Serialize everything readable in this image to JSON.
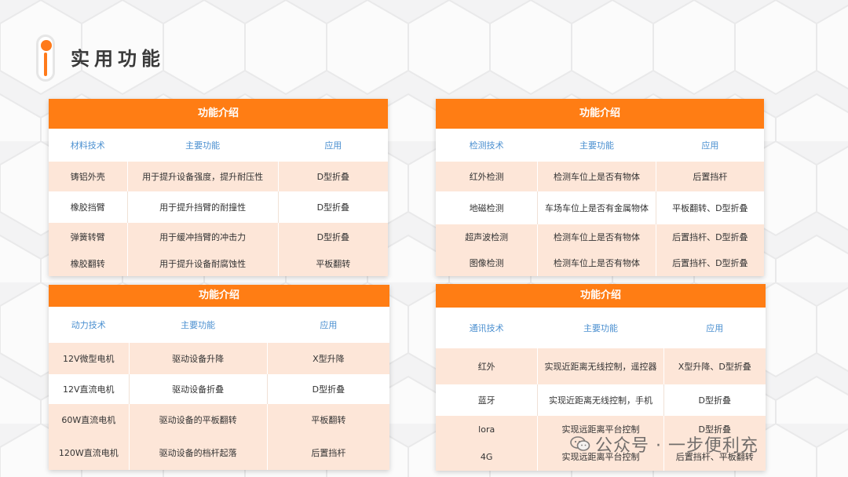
{
  "page": {
    "title": "实用功能"
  },
  "watermark": "公众号 · 一步便利充",
  "colors": {
    "accent": "#ff7d14",
    "row_shade": "#fde6d8",
    "header_text": "#4a8fd0"
  },
  "cards": [
    {
      "title": "功能介绍",
      "headers": [
        "材料技术",
        "主要功能",
        "应用"
      ],
      "rows": [
        [
          "铸铝外壳",
          "用于提升设备强度，提升耐压性",
          "D型折叠"
        ],
        [
          "橡胶挡臂",
          "用于提升挡臂的耐撞性",
          "D型折叠"
        ],
        [
          "弹簧转臂",
          "用于缓冲挡臂的冲击力",
          "D型折叠"
        ],
        [
          "橡胶翻转",
          "用于提升设备耐腐蚀性",
          "平板翻转"
        ]
      ]
    },
    {
      "title": "功能介绍",
      "headers": [
        "检测技术",
        "主要功能",
        "应用"
      ],
      "rows": [
        [
          "红外检测",
          "检测车位上是否有物体",
          "后置挡杆"
        ],
        [
          "地磁检测",
          "车场车位上是否有金属物体",
          "平板翻转、D型折叠"
        ],
        [
          "超声波检测",
          "检测车位上是否有物体",
          "后置挡杆、D型折叠"
        ],
        [
          "图像检测",
          "检测车位上是否有物体",
          "后置挡杆、D型折叠"
        ]
      ]
    },
    {
      "title": "功能介绍",
      "headers": [
        "动力技术",
        "主要功能",
        "应用"
      ],
      "rows": [
        [
          "12V微型电机",
          "驱动设备升降",
          "X型升降"
        ],
        [
          "12V直流电机",
          "驱动设备折叠",
          "D型折叠"
        ],
        [
          "60W直流电机",
          "驱动设备的平板翻转",
          "平板翻转"
        ],
        [
          "120W直流电机",
          "驱动设备的档杆起落",
          "后置挡杆"
        ]
      ]
    },
    {
      "title": "功能介绍",
      "headers": [
        "通讯技术",
        "主要功能",
        "应用"
      ],
      "rows": [
        [
          "红外",
          "实现近距离无线控制，遥控器",
          "X型升降、D型折叠"
        ],
        [
          "蓝牙",
          "实现近距离无线控制，手机",
          "D型折叠"
        ],
        [
          "lora",
          "实现远距离平台控制",
          "D型折叠"
        ],
        [
          "4G",
          "实现远距离平台控制",
          "后置挡杆、平板翻转"
        ]
      ]
    }
  ]
}
